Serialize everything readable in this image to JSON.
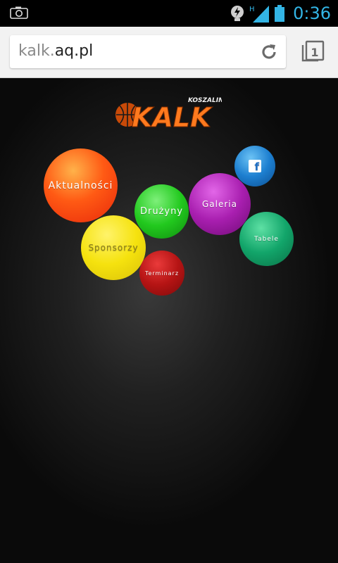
{
  "status_bar": {
    "time": "0:36",
    "network": "H",
    "icons": [
      "camera-icon",
      "power-icon",
      "signal-icon",
      "battery-icon"
    ],
    "time_color": "#33b5e5"
  },
  "browser": {
    "url_host_prefix": "kalk.",
    "url_host": "aq.pl",
    "tab_count": "1",
    "icons": [
      "reload-icon",
      "tabs-icon"
    ]
  },
  "site": {
    "logo": {
      "top_text": "KOSZALIN",
      "main_text": "KALK"
    },
    "menu": [
      {
        "label": "Aktualności",
        "color": "#ff5a14"
      },
      {
        "label": "Drużyny",
        "color": "#22c91e"
      },
      {
        "label": "Galeria",
        "color": "#a91fb0"
      },
      {
        "label": "Sponsorzy",
        "color": "#f5e20e"
      },
      {
        "label": "Terminarz",
        "color": "#b51414"
      },
      {
        "label": "Tabele",
        "color": "#12a56a"
      }
    ],
    "facebook": {
      "label": "f",
      "color": "#1d7fd0"
    }
  }
}
